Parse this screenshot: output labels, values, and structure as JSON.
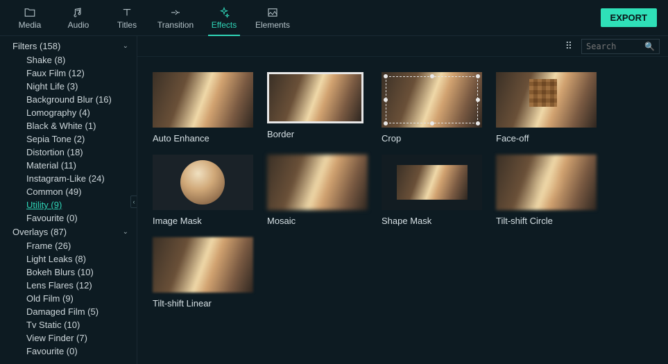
{
  "tabs": {
    "media": "Media",
    "audio": "Audio",
    "titles": "Titles",
    "transition": "Transition",
    "effects": "Effects",
    "elements": "Elements"
  },
  "export_label": "EXPORT",
  "search_placeholder": "Search",
  "sidebar": {
    "filters": {
      "label": "Filters (158)"
    },
    "filters_items": [
      "Shake (8)",
      "Faux Film (12)",
      "Night Life (3)",
      "Background Blur (16)",
      "Lomography (4)",
      "Black & White (1)",
      "Sepia Tone (2)",
      "Distortion (18)",
      "Material (11)",
      "Instagram-Like (24)",
      "Common (49)",
      "Utility (9)",
      "Favourite (0)"
    ],
    "overlays": {
      "label": "Overlays (87)"
    },
    "overlays_items": [
      "Frame (26)",
      "Light Leaks (8)",
      "Bokeh Blurs (10)",
      "Lens Flares (12)",
      "Old Film (9)",
      "Damaged Film (5)",
      "Tv Static (10)",
      "View Finder (7)",
      "Favourite (0)"
    ]
  },
  "effects": {
    "e0": "Auto Enhance",
    "e1": "Border",
    "e2": "Crop",
    "e3": "Face-off",
    "e4": "Image Mask",
    "e5": "Mosaic",
    "e6": "Shape Mask",
    "e7": "Tilt-shift Circle",
    "e8": "Tilt-shift Linear"
  }
}
